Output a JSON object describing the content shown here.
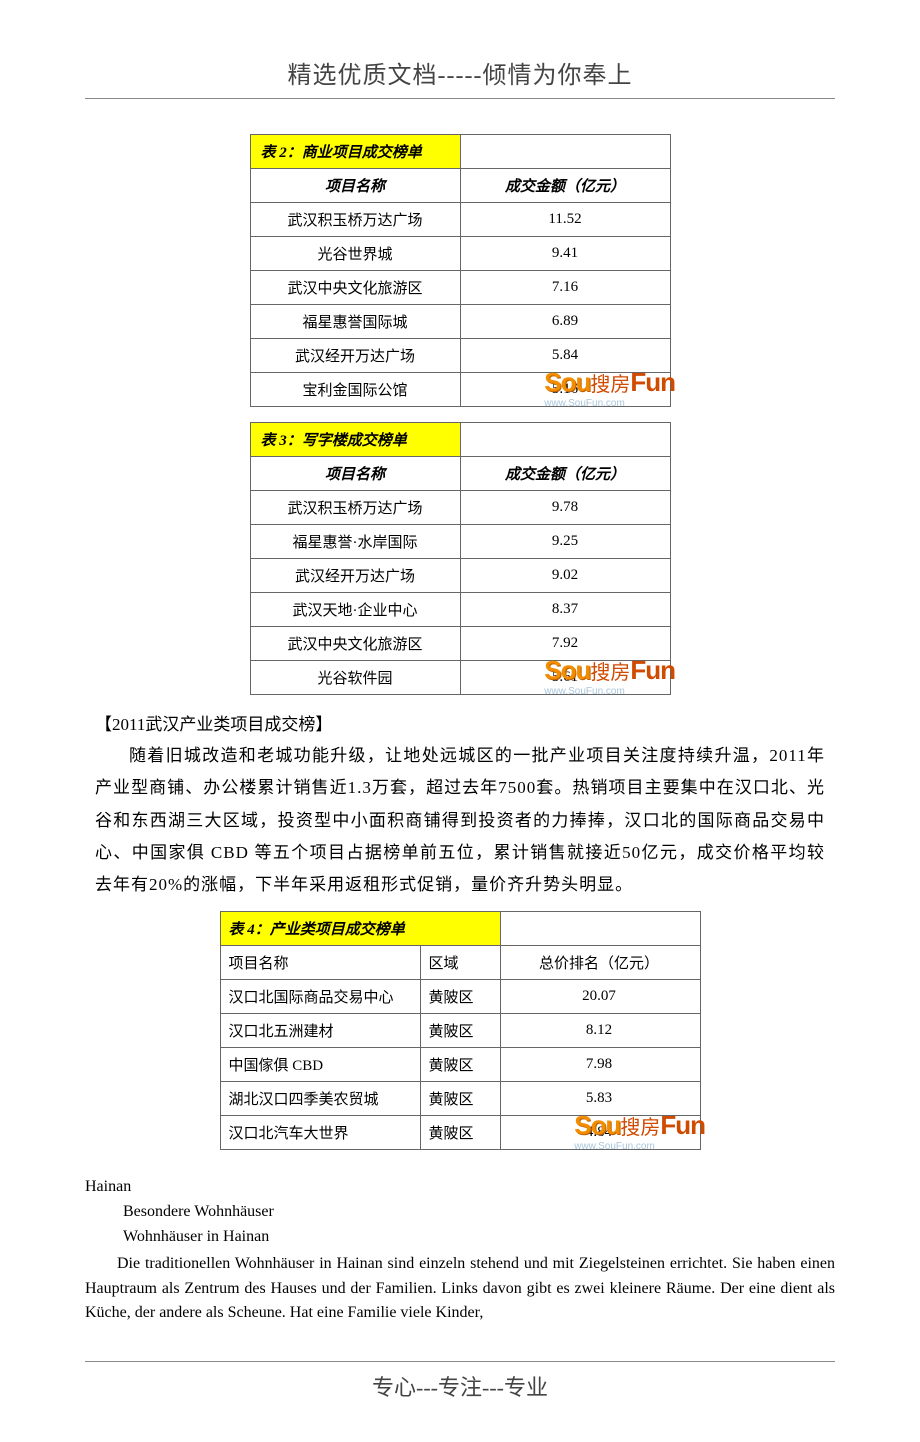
{
  "header": "精选优质文档-----倾情为你奉上",
  "footer": "专心---专注---专业",
  "watermark": {
    "brand_latin": "SouFun",
    "brand_cn": "搜房",
    "url": "www.SouFun.com"
  },
  "table2": {
    "title": "表 2：商业项目成交榜单",
    "col_name": "项目名称",
    "col_value": "成交金额（亿元）",
    "rows": [
      {
        "name": "武汉积玉桥万达广场",
        "value": "11.52"
      },
      {
        "name": "光谷世界城",
        "value": "9.41"
      },
      {
        "name": "武汉中央文化旅游区",
        "value": "7.16"
      },
      {
        "name": "福星惠誉国际城",
        "value": "6.89"
      },
      {
        "name": "武汉经开万达广场",
        "value": "5.84"
      },
      {
        "name": "宝利金国际公馆",
        "value": "5.16"
      }
    ]
  },
  "table3": {
    "title": "表 3：写字楼成交榜单",
    "col_name": "项目名称",
    "col_value": "成交金额（亿元）",
    "rows": [
      {
        "name": "武汉积玉桥万达广场",
        "value": "9.78"
      },
      {
        "name": "福星惠誉·水岸国际",
        "value": "9.25"
      },
      {
        "name": "武汉经开万达广场",
        "value": "9.02"
      },
      {
        "name": "武汉天地·企业中心",
        "value": "8.37"
      },
      {
        "name": "武汉中央文化旅游区",
        "value": "7.92"
      },
      {
        "name": "光谷软件园",
        "value": "5.61"
      }
    ]
  },
  "section": {
    "heading": "【2011武汉产业类项目成交榜】",
    "body": "随着旧城改造和老城功能升级，让地处远城区的一批产业项目关注度持续升温，2011年产业型商铺、办公楼累计销售近1.3万套，超过去年7500套。热销项目主要集中在汉口北、光谷和东西湖三大区域，投资型中小面积商铺得到投资者的力捧捧，汉口北的国际商品交易中心、中国家俱 CBD 等五个项目占据榜单前五位，累计销售就接近50亿元，成交价格平均较去年有20%的涨幅，下半年采用返租形式促销，量价齐升势头明显。"
  },
  "table4": {
    "title": "表 4：产业类项目成交榜单",
    "col_name": "项目名称",
    "col_region": "区域",
    "col_value": "总价排名（亿元）",
    "rows": [
      {
        "name": "汉口北国际商品交易中心",
        "region": "黄陂区",
        "value": "20.07"
      },
      {
        "name": "汉口北五洲建材",
        "region": "黄陂区",
        "value": "8.12"
      },
      {
        "name": "中国傢俱 CBD",
        "region": "黄陂区",
        "value": "7.98"
      },
      {
        "name": "湖北汉口四季美农贸城",
        "region": "黄陂区",
        "value": "5.83"
      },
      {
        "name": "汉口北汽车大世界",
        "region": "黄陂区",
        "value": "4.84"
      }
    ]
  },
  "german": {
    "line1": "Hainan",
    "line2": "Besondere Wohnhäuser",
    "line3": "Wohnhäuser in Hainan",
    "para": "Die traditionellen Wohnhäuser in Hainan sind einzeln stehend und mit Ziegelsteinen errichtet. Sie haben einen Hauptraum als Zentrum des Hauses und der Familien. Links davon gibt es zwei kleinere Räume. Der eine dient als Küche, der andere als Scheune. Hat eine Familie viele Kinder,"
  }
}
